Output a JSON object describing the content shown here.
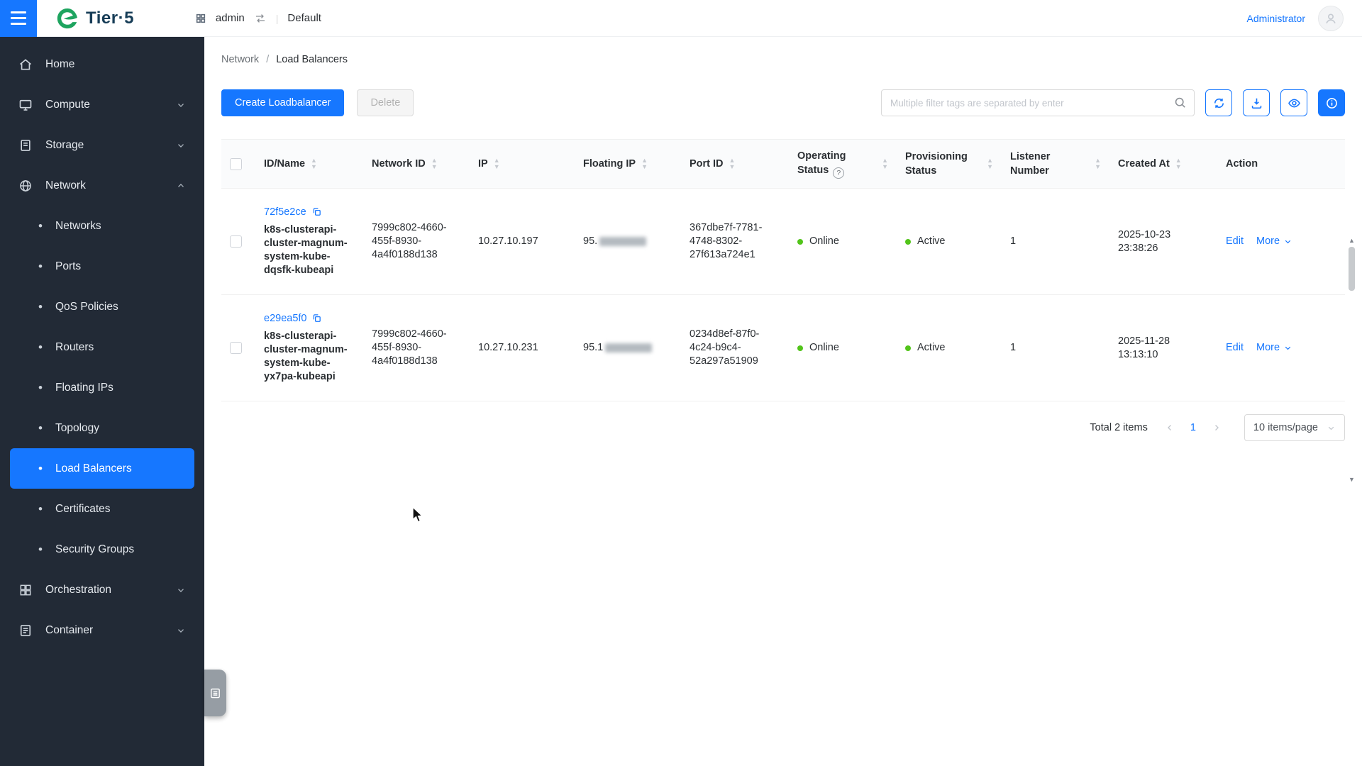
{
  "colors": {
    "accent": "#1677ff",
    "sidebar_bg": "#222a36",
    "success_green": "#52c41a",
    "brand_green": "#1ea45f",
    "brand_text_color": "#173d57"
  },
  "icons": {
    "caret_up": "▲",
    "caret_down": "▼",
    "bullet": "•",
    "question": "?",
    "scroll_up": "▲",
    "scroll_down": "▼"
  },
  "header": {
    "brand": "Tier·5",
    "project": "admin",
    "divider": "|",
    "workspace": "Default",
    "user": "Administrator"
  },
  "sidebar": {
    "items": [
      {
        "label": "Home"
      },
      {
        "label": "Compute"
      },
      {
        "label": "Storage"
      },
      {
        "label": "Network"
      },
      {
        "label": "Orchestration"
      },
      {
        "label": "Container"
      }
    ],
    "network_children": [
      {
        "label": "Networks"
      },
      {
        "label": "Ports"
      },
      {
        "label": "QoS Policies"
      },
      {
        "label": "Routers"
      },
      {
        "label": "Floating IPs"
      },
      {
        "label": "Topology"
      },
      {
        "label": "Load Balancers"
      },
      {
        "label": "Certificates"
      },
      {
        "label": "Security Groups"
      }
    ],
    "active_item": "Load Balancers"
  },
  "breadcrumb": {
    "items": [
      "Network",
      "Load Balancers"
    ],
    "separator": "/"
  },
  "toolbar": {
    "create_label": "Create Loadbalancer",
    "delete_label": "Delete",
    "filter_placeholder": "Multiple filter tags are separated by enter"
  },
  "table": {
    "columns": {
      "id_name": "ID/Name",
      "network_id": "Network ID",
      "ip": "IP",
      "floating_ip": "Floating IP",
      "port_id": "Port ID",
      "operating_status": "Operating Status",
      "provisioning_status": "Provisioning Status",
      "listener_number": "Listener Number",
      "created_at": "Created At",
      "action": "Action"
    },
    "rows": [
      {
        "id": "72f5e2ce",
        "name": "k8s-clusterapi-cluster-magnum-system-kube-dqsfk-kubeapi",
        "network_id": "7999c802-4660-455f-8930-4a4f0188d138",
        "ip": "10.27.10.197",
        "floating_ip_visible": "95.",
        "port_id": "367dbe7f-7781-4748-8302-27f613a724e1",
        "operating_status": "Online",
        "provisioning_status": "Active",
        "listener_number": "1",
        "created_at": "2025-10-23 23:38:26",
        "edit_label": "Edit",
        "more_label": "More"
      },
      {
        "id": "e29ea5f0",
        "name": "k8s-clusterapi-cluster-magnum-system-kube-yx7pa-kubeapi",
        "network_id": "7999c802-4660-455f-8930-4a4f0188d138",
        "ip": "10.27.10.231",
        "floating_ip_visible": "95.1",
        "port_id": "0234d8ef-87f0-4c24-b9c4-52a297a51909",
        "operating_status": "Online",
        "provisioning_status": "Active",
        "listener_number": "1",
        "created_at": "2025-11-28 13:13:10",
        "edit_label": "Edit",
        "more_label": "More"
      }
    ]
  },
  "pagination": {
    "total_text": "Total 2 items",
    "current_page": "1",
    "page_size": "10 items/page"
  }
}
